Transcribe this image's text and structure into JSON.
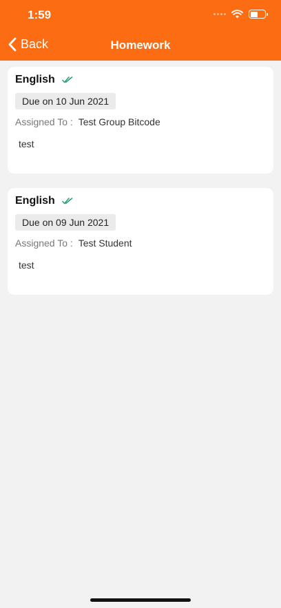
{
  "status_bar": {
    "time": "1:59"
  },
  "nav": {
    "back_label": "Back",
    "title": "Homework"
  },
  "homework": [
    {
      "subject": "English",
      "due": "Due on 10 Jun 2021",
      "assigned_label": "Assigned To :",
      "assigned_to": "Test Group Bitcode",
      "description": "test"
    },
    {
      "subject": "English",
      "due": "Due on 09 Jun 2021",
      "assigned_label": "Assigned To :",
      "assigned_to": "Test Student",
      "description": "test"
    }
  ],
  "colors": {
    "header": "#fc6c12",
    "background": "#f2f2f2",
    "check": "#2a9d6e"
  },
  "icons": [
    "wifi-icon",
    "battery-icon",
    "chevron-left-icon",
    "double-check-icon"
  ]
}
